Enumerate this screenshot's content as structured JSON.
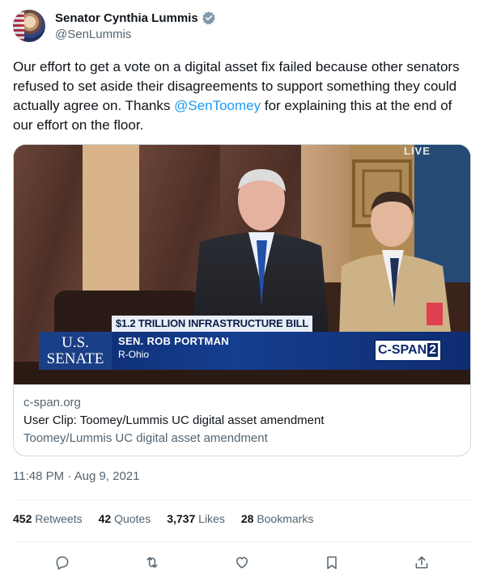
{
  "author": {
    "display_name": "Senator Cynthia Lummis",
    "handle": "@SenLummis"
  },
  "tweet": {
    "text_before": "Our effort to get a vote on a digital asset fix failed because other senators refused to set aside their disagreements to support something they could actually agree on. Thanks ",
    "mention": "@SenToomey",
    "text_after": " for explaining this at the end of our effort on the floor."
  },
  "media": {
    "live_label": "LIVE",
    "lower_third_title": "$1.2 TRILLION INFRASTRUCTURE BILL",
    "network_line1": "U.S.",
    "network_line2": "SENATE",
    "speaker_name": "SEN. ROB PORTMAN",
    "speaker_party": "R-Ohio",
    "channel_name": "C-SPAN",
    "channel_number": "2"
  },
  "card": {
    "domain": "c-span.org",
    "title": "User Clip: Toomey/Lummis UC digital asset amendment",
    "description": "Toomey/Lummis UC digital asset amendment"
  },
  "timestamp": "11:48 PM · Aug 9, 2021",
  "stats": [
    {
      "count": "452",
      "label": "Retweets"
    },
    {
      "count": "42",
      "label": "Quotes"
    },
    {
      "count": "3,737",
      "label": "Likes"
    },
    {
      "count": "28",
      "label": "Bookmarks"
    }
  ],
  "actions": [
    "reply-icon",
    "retweet-icon",
    "like-icon",
    "bookmark-icon",
    "share-icon"
  ],
  "colors": {
    "accent": "#1d9bf0",
    "text": "#0f1419",
    "secondary": "#536471",
    "border": "#cfd9de"
  }
}
